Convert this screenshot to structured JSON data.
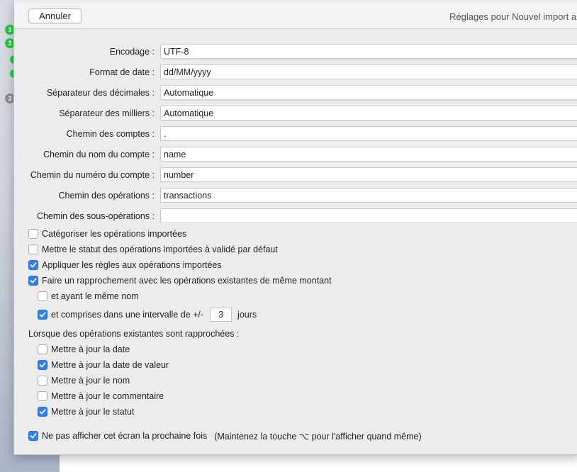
{
  "background": {
    "badges": [
      {
        "text": "3",
        "color": "#28c840"
      },
      {
        "text": "3",
        "color": "#28c840"
      },
      {
        "text": "",
        "color": "#28c840"
      },
      {
        "text": "",
        "color": "#28c840"
      },
      {
        "text": "3",
        "color": "#8e8e93"
      }
    ]
  },
  "sheet": {
    "cancel_label": "Annuler",
    "title": "Réglages pour Nouvel import a",
    "fields": [
      {
        "label": "Encodage :",
        "value": "UTF-8",
        "kind": "select"
      },
      {
        "label": "Format de date :",
        "value": "dd/MM/yyyy",
        "kind": "text"
      },
      {
        "label": "Séparateur des décimales :",
        "value": "Automatique",
        "kind": "select"
      },
      {
        "label": "Séparateur des milliers :",
        "value": "Automatique",
        "kind": "select"
      },
      {
        "label": "Chemin des comptes :",
        "value": ".",
        "kind": "text"
      },
      {
        "label": "Chemin du nom du compte :",
        "value": "name",
        "kind": "text"
      },
      {
        "label": "Chemin du numéro du compte :",
        "value": "number",
        "kind": "text"
      },
      {
        "label": "Chemin des opérations :",
        "value": "transactions",
        "kind": "text"
      },
      {
        "label": "Chemin des sous-opérations :",
        "value": "",
        "kind": "text"
      }
    ],
    "options": [
      {
        "label": "Catégoriser les opérations importées",
        "checked": false
      },
      {
        "label": "Mettre le statut des opérations importées à validé par défaut",
        "checked": false
      },
      {
        "label": "Appliquer les règles aux opérations importées",
        "checked": true
      },
      {
        "label": "Faire un rapprochement avec les opérations existantes de même montant",
        "checked": true
      }
    ],
    "match_options": {
      "same_name": {
        "label": "et ayant le même nom",
        "checked": false
      },
      "interval": {
        "label": "et comprises dans une intervalle de +/-",
        "checked": true,
        "value": "3",
        "unit": "jours"
      }
    },
    "update_section_label": "Lorsque des opérations existantes sont rapprochées :",
    "update_options": [
      {
        "label": "Mettre à jour la date",
        "checked": false
      },
      {
        "label": "Mettre à jour la date de valeur",
        "checked": true
      },
      {
        "label": "Mettre à jour le nom",
        "checked": false
      },
      {
        "label": "Mettre à jour le commentaire",
        "checked": false
      },
      {
        "label": "Mettre à jour le statut",
        "checked": true
      }
    ],
    "dont_show": {
      "label": "Ne pas afficher cet écran la prochaine fois",
      "hint": "(Maintenez la touche ⌥ pour l'afficher quand même)",
      "checked": true
    },
    "accent_color": "#2d7ff6"
  }
}
